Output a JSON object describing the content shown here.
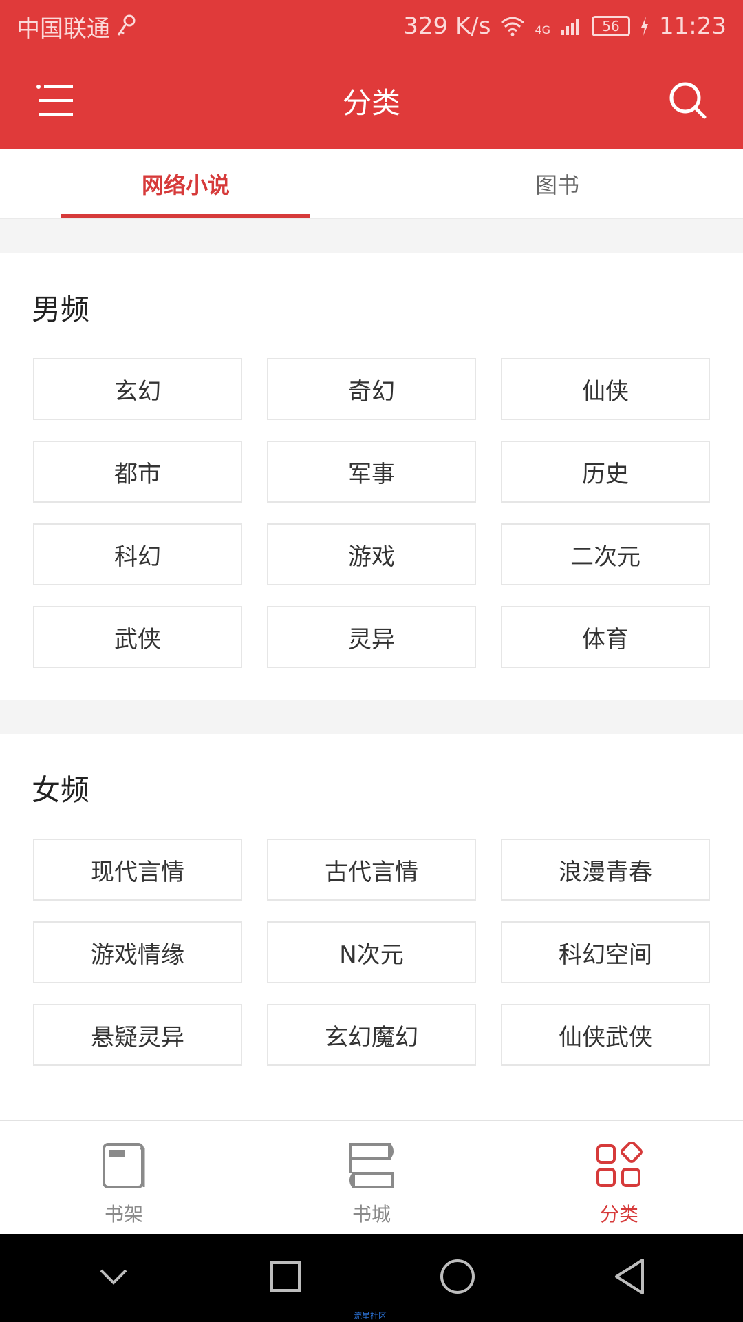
{
  "status_bar": {
    "carrier": "中国联通",
    "speed": "329 K/s",
    "network": "4G",
    "battery": "56",
    "time": "11:23"
  },
  "app_bar": {
    "title": "分类",
    "menu_icon": "menu-icon",
    "search_icon": "search-icon"
  },
  "tabs": [
    {
      "label": "网络小说",
      "active": true
    },
    {
      "label": "图书",
      "active": false
    }
  ],
  "sections": {
    "male": {
      "title": "男频",
      "items": [
        "玄幻",
        "奇幻",
        "仙侠",
        "都市",
        "军事",
        "历史",
        "科幻",
        "游戏",
        "二次元",
        "武侠",
        "灵异",
        "体育"
      ]
    },
    "female": {
      "title": "女频",
      "items": [
        "现代言情",
        "古代言情",
        "浪漫青春",
        "游戏情缘",
        "N次元",
        "科幻空间",
        "悬疑灵异",
        "玄幻魔幻",
        "仙侠武侠"
      ]
    }
  },
  "bottom_nav": [
    {
      "label": "书架",
      "icon": "bookshelf-icon",
      "active": false
    },
    {
      "label": "书城",
      "icon": "bookstore-icon",
      "active": false
    },
    {
      "label": "分类",
      "icon": "category-icon",
      "active": true
    }
  ],
  "system_nav": [
    "collapse-icon",
    "recents-icon",
    "home-icon",
    "back-icon"
  ],
  "watermark": "流星社区",
  "colors": {
    "accent": "#e03a3a",
    "accent_text": "#d63a3a",
    "border": "#e6e6e6",
    "background": "#f4f4f4"
  }
}
